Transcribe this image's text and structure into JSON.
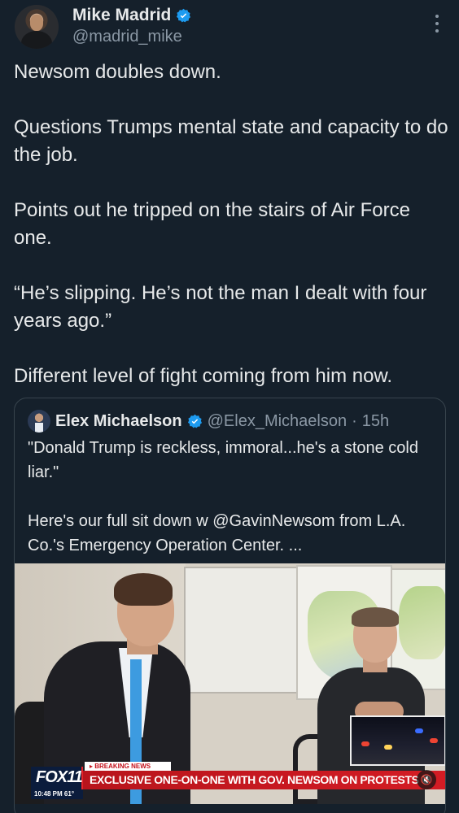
{
  "author": {
    "name": "Mike Madrid",
    "handle": "@madrid_mike",
    "verified": true
  },
  "tweet": {
    "paragraphs": [
      "Newsom doubles down.",
      "Questions Trumps mental state and capacity to do the job.",
      "Points out he tripped on the stairs of Air Force one.",
      "“He’s slipping. He’s not the man I dealt with four years ago.”",
      "Different level of fight coming from him now."
    ]
  },
  "quoted": {
    "name": "Elex Michaelson",
    "handle": "@Elex_Michaelson",
    "separator": "·",
    "time": "15h",
    "paragraphs": [
      "\"Donald Trump is reckless, immoral...he's a stone cold liar.\"",
      "Here's our full sit down w @GavinNewsom from L.A. Co.'s Emergency Operation Center.  ..."
    ],
    "video": {
      "breaking_label": "▸ BREAKING NEWS",
      "headline": "EXCLUSIVE ONE-ON-ONE WITH GOV. NEWSOM ON PROTESTS",
      "station": "FOX11",
      "time": "10:48 PM",
      "temperature": "61°",
      "mute_icon": "speaker-muted-icon"
    }
  },
  "colors": {
    "background": "#15202b",
    "text": "#e7e9ea",
    "secondary": "#8b98a5",
    "verified": "#1d9bf0",
    "border": "#38444d"
  }
}
